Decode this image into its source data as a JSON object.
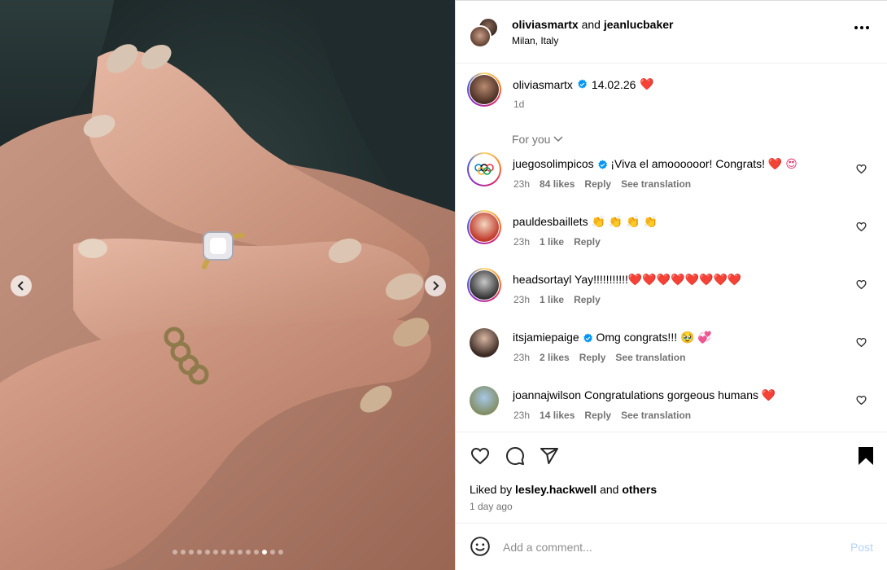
{
  "post": {
    "author_primary": "oliviasmartx",
    "and_word": "and",
    "author_collab": "jeanlucbaker",
    "location": "Milan, Italy"
  },
  "caption": {
    "username": "oliviasmartx",
    "text": "14.02.26",
    "emoji": "❤️",
    "time": "1d"
  },
  "for_you_label": "For you",
  "comments": [
    {
      "username": "juegosolimpicos",
      "verified": true,
      "text": "¡Viva el amoooooor! Congrats! ",
      "emoji": "❤️ 😍",
      "time": "23h",
      "likes": "84 likes",
      "reply": "Reply",
      "translate": "See translation"
    },
    {
      "username": "pauldesbaillets",
      "verified": false,
      "text": "",
      "emoji": "👏 👏 👏 👏",
      "time": "23h",
      "likes": "1 like",
      "reply": "Reply",
      "translate": ""
    },
    {
      "username": "headsortayl",
      "verified": false,
      "text": "Yay!!!!!!!!!!!",
      "emoji": "❤️❤️❤️❤️❤️❤️❤️❤️",
      "time": "23h",
      "likes": "1 like",
      "reply": "Reply",
      "translate": ""
    },
    {
      "username": "itsjamiepaige",
      "verified": true,
      "text": "Omg congrats!!! ",
      "emoji": "🥹 💞",
      "time": "23h",
      "likes": "2 likes",
      "reply": "Reply",
      "translate": "See translation"
    },
    {
      "username": "joannajwilson",
      "verified": false,
      "text": "Congratulations gorgeous humans ",
      "emoji": "❤️",
      "time": "23h",
      "likes": "14 likes",
      "reply": "Reply",
      "translate": "See translation"
    }
  ],
  "liked_by": {
    "prefix": "Liked by",
    "user": "lesley.hackwell",
    "and": "and",
    "others": "others"
  },
  "posted_ago": "1 day ago",
  "comment_input": {
    "placeholder": "Add a comment...",
    "value": ""
  },
  "post_button": "Post",
  "carousel": {
    "total_slides": 14,
    "active_index": 11
  },
  "colors": {
    "verified": "#0095f6",
    "heart": "#e8336a",
    "post_disabled": "#b3d4fc",
    "muted": "#737373"
  },
  "icons": [
    "more-icon",
    "chevron-down-icon",
    "heart-icon",
    "comment-icon",
    "share-icon",
    "bookmark-icon",
    "smile-icon",
    "chevron-left-icon",
    "chevron-right-icon",
    "verified-badge-icon"
  ]
}
